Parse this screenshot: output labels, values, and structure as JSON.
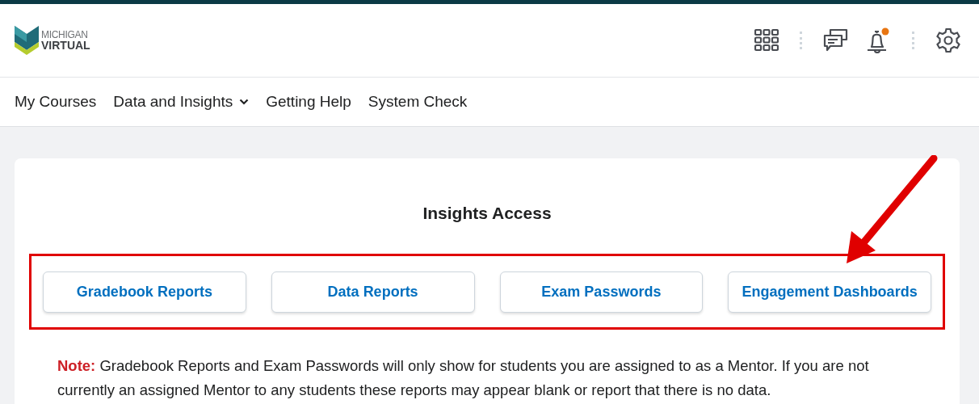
{
  "logo": {
    "line_1": "MICHIGAN",
    "line_2": "VIRTUAL"
  },
  "header_icons": {
    "notification_badge": true
  },
  "nav": [
    {
      "label": "My Courses",
      "dropdown": false
    },
    {
      "label": "Data and Insights",
      "dropdown": true
    },
    {
      "label": "Getting Help",
      "dropdown": false
    },
    {
      "label": "System Check",
      "dropdown": false
    }
  ],
  "card": {
    "title": "Insights Access",
    "buttons": [
      "Gradebook Reports",
      "Data Reports",
      "Exam Passwords",
      "Engagement Dashboards"
    ],
    "note": "**Note:** Gradebook Reports and Exam Passwords will only show for students you are assigned to as a Mentor. If you are not currently an assigned Mentor to any students these reports may appear blank or report that there is no data."
  }
}
